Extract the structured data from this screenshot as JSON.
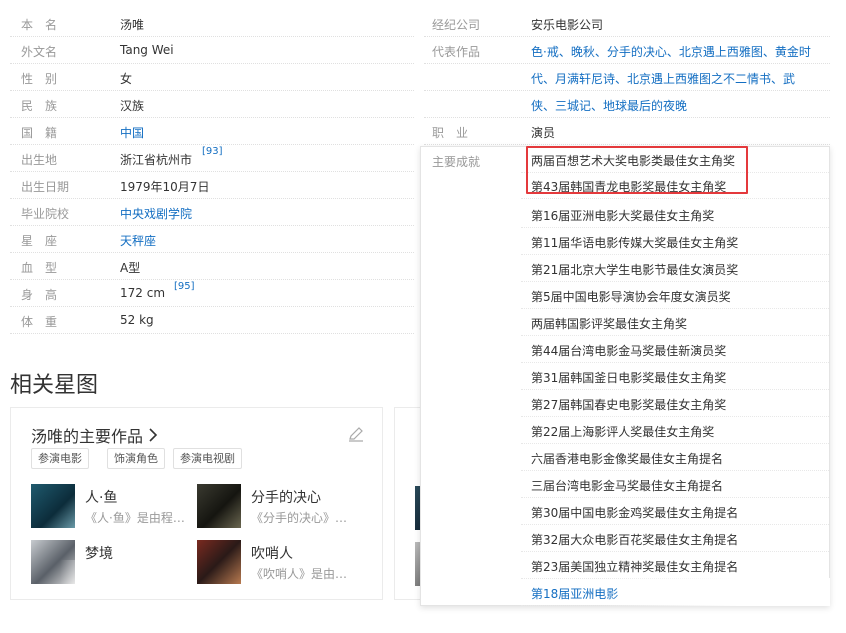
{
  "info_left": [
    {
      "label": "本　名",
      "value": "汤唯",
      "link": false
    },
    {
      "label": "外文名",
      "value": "Tang Wei",
      "link": false
    },
    {
      "label": "性　别",
      "value": "女",
      "link": false
    },
    {
      "label": "民　族",
      "value": "汉族",
      "link": false
    },
    {
      "label": "国　籍",
      "value": "中国",
      "link": true
    },
    {
      "label": "出生地",
      "value": "浙江省杭州市",
      "link": false,
      "sup": "[93]"
    },
    {
      "label": "出生日期",
      "value": "1979年10月7日",
      "link": false
    },
    {
      "label": "毕业院校",
      "value": "中央戏剧学院",
      "link": true
    },
    {
      "label": "星　座",
      "value": "天秤座",
      "link": true
    },
    {
      "label": "血　型",
      "value": "A型",
      "link": false
    },
    {
      "label": "身　高",
      "value": "172 cm",
      "link": false,
      "sup": "[95]"
    },
    {
      "label": "体　重",
      "value": "52 kg",
      "link": false
    }
  ],
  "info_right": {
    "agency_label": "经纪公司",
    "agency_value": "安乐电影公司",
    "works_label": "代表作品",
    "works_lines": [
      "色·戒、晚秋、分手的决心、北京遇上西雅图、黄金时",
      "代、月满轩尼诗、北京遇上西雅图之不二情书、武",
      "侠、三城记、地球最后的夜晚"
    ],
    "job_label": "职　业",
    "job_value": "演员"
  },
  "achievements": {
    "label": "主要成就",
    "items": [
      "两届百想艺术大奖电影类最佳女主角奖",
      "第43届韩国青龙电影奖最佳女主角奖",
      "第16届亚洲电影大奖最佳女主角奖",
      "第11届华语电影传媒大奖最佳女主角奖",
      "第21届北京大学生电影节最佳女演员奖",
      "第5届中国电影导演协会年度女演员奖",
      "两届韩国影评奖最佳女主角奖",
      "第44届台湾电影金马奖最佳新演员奖",
      "第31届韩国釜日电影奖最佳女主角奖",
      "第27届韩国春史电影奖最佳女主角奖",
      "第22届上海影评人奖最佳女主角奖",
      "六届香港电影金像奖最佳女主角提名",
      "三届台湾电影金马奖最佳女主角提名",
      "第30届中国电影金鸡奖最佳女主角提名",
      "第32届大众电影百花奖最佳女主角提名",
      "第23届美国独立精神奖最佳女主角提名",
      "第18届亚洲电影"
    ],
    "highlight_color": "#e4393c"
  },
  "section": {
    "title": "相关星图",
    "card_title": "汤唯的主要作品",
    "tags": [
      "参演电影",
      "饰演角色",
      "参演电视剧"
    ],
    "works": [
      {
        "title": "人·鱼",
        "desc": "《人·鱼》是由程…"
      },
      {
        "title": "分手的决心",
        "desc": "《分手的决心》…"
      },
      {
        "title": "梦境",
        "desc": ""
      },
      {
        "title": "吹哨人",
        "desc": "《吹哨人》是由…"
      }
    ]
  },
  "colors": {
    "link": "#136ec2",
    "label": "#999999",
    "text": "#333333"
  },
  "icons": [
    "chevron-right-icon",
    "edit-pencil-icon"
  ]
}
